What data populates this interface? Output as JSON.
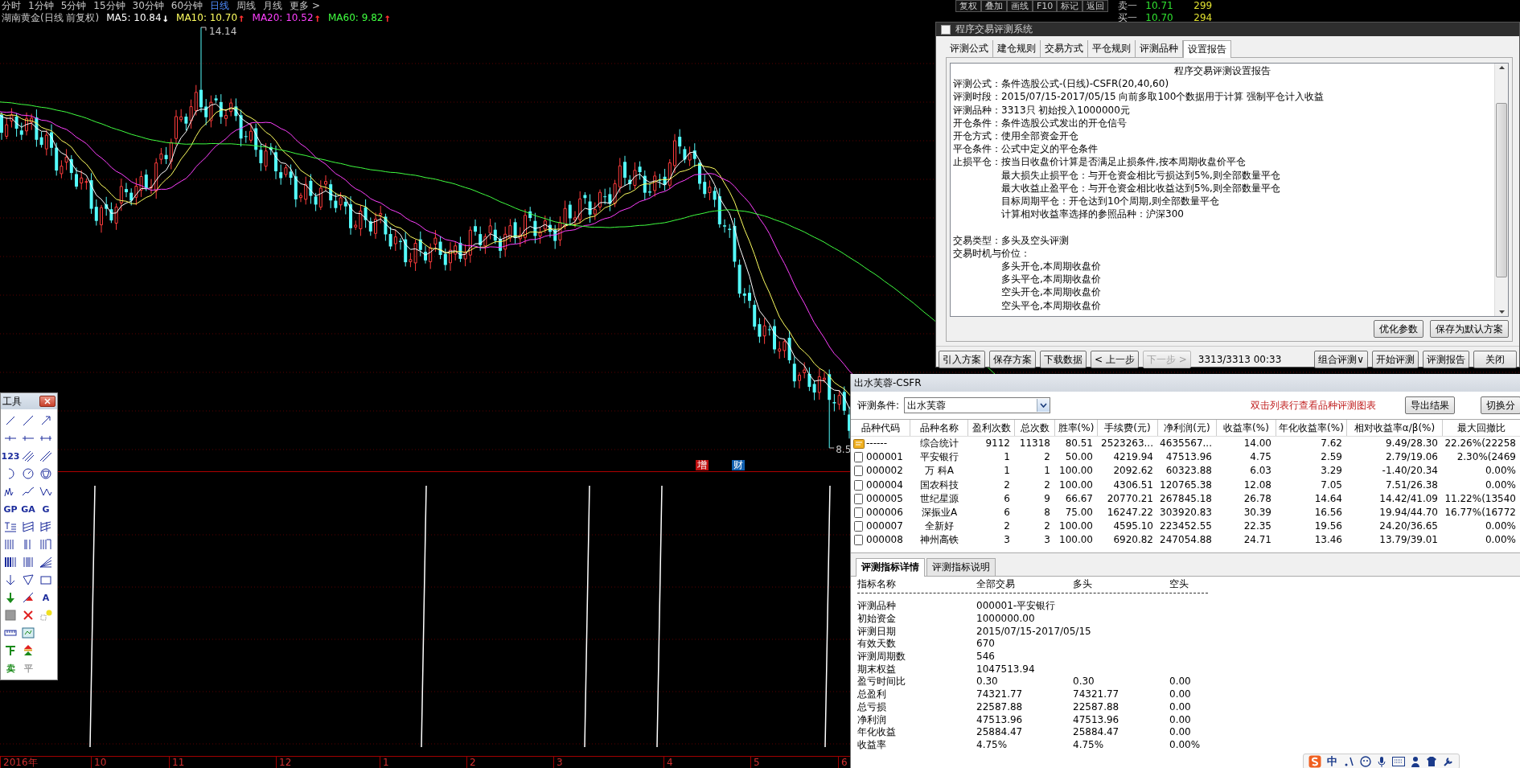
{
  "period_bar": {
    "periods": [
      {
        "label": "分时",
        "selected": false
      },
      {
        "label": "1分钟",
        "selected": false
      },
      {
        "label": "5分钟",
        "selected": false
      },
      {
        "label": "15分钟",
        "selected": false
      },
      {
        "label": "30分钟",
        "selected": false
      },
      {
        "label": "60分钟",
        "selected": false
      },
      {
        "label": "日线",
        "selected": true
      },
      {
        "label": "周线",
        "selected": false
      },
      {
        "label": "月线",
        "selected": false
      },
      {
        "label": "更多 >",
        "selected": false
      }
    ],
    "tools": [
      "复权",
      "叠加",
      "画线",
      "F10",
      "标记",
      "返回"
    ]
  },
  "quote": {
    "rows": [
      {
        "label": "卖一",
        "price": "10.71",
        "volume": "299"
      },
      {
        "label": "买一",
        "price": "10.70",
        "volume": "294"
      }
    ]
  },
  "chart": {
    "title": "湖南黄金(日线 前复权)",
    "ma": [
      {
        "label": "MA5: 10.84",
        "arrow": {
          "text": "↓",
          "color": "#ffffff"
        },
        "color": "#ffffff"
      },
      {
        "label": "MA10: 10.70",
        "arrow": {
          "text": "↑",
          "color": "#ff3030"
        },
        "color": "#ffff60"
      },
      {
        "label": "MA20: 10.52",
        "arrow": {
          "text": "↑",
          "color": "#ff3030"
        },
        "color": "#ff40ff"
      },
      {
        "label": "MA60: 9.82",
        "arrow": {
          "text": "↑",
          "color": "#ff3030"
        },
        "color": "#40ff40"
      }
    ],
    "high_label": "14.14",
    "low_label": "8.5",
    "markers": [
      {
        "label": "增",
        "color": "#c01010"
      },
      {
        "label": "财",
        "color": "#1060b0"
      }
    ],
    "x_axis": [
      "2016年",
      "10",
      "11",
      "12",
      "1",
      "2",
      "3",
      "4",
      "5",
      "6"
    ]
  },
  "toolbox": {
    "title": "工具",
    "tools": [
      {
        "kind": "icon"
      },
      {
        "kind": "icon"
      },
      {
        "kind": "icon"
      },
      {
        "kind": "icon"
      },
      {
        "kind": "icon"
      },
      {
        "kind": "icon"
      },
      {
        "kind": "text",
        "label": "123",
        "disabled": false
      },
      {
        "kind": "icon"
      },
      {
        "kind": "icon"
      },
      {
        "kind": "icon"
      },
      {
        "kind": "icon"
      },
      {
        "kind": "icon"
      },
      {
        "kind": "icon"
      },
      {
        "kind": "icon"
      },
      {
        "kind": "icon"
      },
      {
        "kind": "text",
        "label": "GP",
        "disabled": false
      },
      {
        "kind": "text",
        "label": "GA",
        "disabled": false
      },
      {
        "kind": "text",
        "label": "G",
        "disabled": false
      },
      {
        "kind": "icon"
      },
      {
        "kind": "icon"
      },
      {
        "kind": "icon"
      },
      {
        "kind": "icon"
      },
      {
        "kind": "icon"
      },
      {
        "kind": "icon"
      },
      {
        "kind": "icon"
      },
      {
        "kind": "icon"
      },
      {
        "kind": "icon"
      },
      {
        "kind": "icon"
      },
      {
        "kind": "icon"
      },
      {
        "kind": "icon"
      },
      {
        "kind": "icon"
      },
      {
        "kind": "icon"
      },
      {
        "kind": "text",
        "label": "A",
        "disabled": false
      },
      {
        "kind": "icon"
      },
      {
        "kind": "icon"
      },
      {
        "kind": "icon"
      },
      {
        "kind": "icon"
      },
      {
        "kind": "icon"
      },
      {
        "kind": "gap"
      },
      {
        "kind": "icon"
      },
      {
        "kind": "icon"
      },
      {
        "kind": "gap"
      },
      {
        "kind": "text",
        "label": "卖",
        "disabled": false
      },
      {
        "kind": "text",
        "label": "平",
        "disabled": true
      }
    ]
  },
  "report_window": {
    "title": "程序交易评测系统",
    "tabs": [
      {
        "label": "评测公式",
        "selected": false
      },
      {
        "label": "建仓规则",
        "selected": false
      },
      {
        "label": "交易方式",
        "selected": false
      },
      {
        "label": "平仓规则",
        "selected": false
      },
      {
        "label": "评测品种",
        "selected": false
      },
      {
        "label": "设置报告",
        "selected": true
      }
    ],
    "report_title": "程序交易评测设置报告",
    "sections": [
      {
        "lines": [
          {
            "kind": "field",
            "text": "评测公式：条件选股公式-(日线)-CSFR(20,40,60)"
          },
          {
            "kind": "field",
            "text": "评测时段：2015/07/15-2017/05/15 向前多取100个数据用于计算 强制平仓计入收益"
          },
          {
            "kind": "field",
            "text": "评测品种：3313只 初始投入1000000元"
          },
          {
            "kind": "field",
            "text": "开仓条件：条件选股公式发出的开仓信号"
          },
          {
            "kind": "field",
            "text": "开仓方式：使用全部资金开仓"
          },
          {
            "kind": "field",
            "text": "平仓条件：公式中定义的平仓条件"
          },
          {
            "kind": "field",
            "text": "止损平仓：按当日收盘价计算是否满足止损条件,按本周期收盘价平仓"
          },
          {
            "kind": "sub",
            "text": "最大损失止损平仓：与开仓资金相比亏损达到5%,则全部数量平仓"
          },
          {
            "kind": "sub",
            "text": "最大收益止盈平仓：与开仓资金相比收益达到5%,则全部数量平仓"
          },
          {
            "kind": "sub",
            "text": "目标周期平仓：开仓达到10个周期,则全部数量平仓"
          },
          {
            "kind": "sub",
            "text": "计算相对收益率选择的参照品种：沪深300"
          }
        ]
      },
      {
        "lines": [
          {
            "kind": "field",
            "text": "交易类型：多头及空头评测"
          },
          {
            "kind": "field",
            "text": "交易时机与价位："
          },
          {
            "kind": "sub",
            "text": "多头开仓,本周期收盘价"
          },
          {
            "kind": "sub",
            "text": "多头平仓,本周期收盘价"
          },
          {
            "kind": "sub",
            "text": "空头开仓,本周期收盘价"
          },
          {
            "kind": "sub",
            "text": "空头平仓,本周期收盘价"
          }
        ]
      }
    ],
    "side_buttons": [
      "优化参数",
      "保存为默认方案"
    ],
    "footer_left": [
      {
        "label": "引入方案",
        "disabled": false
      },
      {
        "label": "保存方案",
        "disabled": false
      },
      {
        "label": "下载数据",
        "disabled": false
      },
      {
        "label": "< 上一步",
        "disabled": false
      },
      {
        "label": "下一步 >",
        "disabled": true
      }
    ],
    "progress": "3313/3313 00:33",
    "footer_right": [
      {
        "label": "组合评测∨",
        "disabled": false
      },
      {
        "label": "开始评测",
        "disabled": false
      },
      {
        "label": "评测报告",
        "disabled": false
      },
      {
        "label": "关闭",
        "disabled": false
      }
    ]
  },
  "result_window": {
    "title": "出水芙蓉-CSFR",
    "condition_label": "评测条件:",
    "condition_value": "出水芙蓉",
    "hint": "双击列表行查看品种评测图表",
    "export_button": "导出结果",
    "switch_button": "切换分",
    "columns": [
      "品种代码",
      "品种名称",
      "盈利次数",
      "总次数",
      "胜率(%)",
      "手续费(元)",
      "净利润(元)",
      "收益率(%)",
      "年化收益率(%)",
      "相对收益率α/β(%)",
      "最大回撤比"
    ],
    "rows": [
      {
        "kind": "summary",
        "cells": [
          "------",
          "综合统计",
          "9112",
          "11318",
          "80.51",
          "2523263...",
          "4635567...",
          "14.00",
          "7.62",
          "9.49/28.30",
          "22.26%(22258"
        ]
      },
      {
        "kind": "stock",
        "cells": [
          "000001",
          "平安银行",
          "1",
          "2",
          "50.00",
          "4219.94",
          "47513.96",
          "4.75",
          "2.59",
          "2.79/19.06",
          "2.30%(2469"
        ]
      },
      {
        "kind": "stock",
        "cells": [
          "000002",
          "万 科A",
          "1",
          "1",
          "100.00",
          "2092.62",
          "60323.88",
          "6.03",
          "3.29",
          "-1.40/20.34",
          "0.00%"
        ]
      },
      {
        "kind": "stock",
        "cells": [
          "000004",
          "国农科技",
          "2",
          "2",
          "100.00",
          "4306.51",
          "120765.38",
          "12.08",
          "7.05",
          "7.51/26.38",
          "0.00%"
        ]
      },
      {
        "kind": "stock",
        "cells": [
          "000005",
          "世纪星源",
          "6",
          "9",
          "66.67",
          "20770.21",
          "267845.18",
          "26.78",
          "14.64",
          "14.42/41.09",
          "11.22%(13540"
        ]
      },
      {
        "kind": "stock",
        "cells": [
          "000006",
          "深振业A",
          "6",
          "8",
          "75.00",
          "16247.22",
          "303920.83",
          "30.39",
          "16.56",
          "19.94/44.70",
          "16.77%(16772"
        ]
      },
      {
        "kind": "stock",
        "cells": [
          "000007",
          "全新好",
          "2",
          "2",
          "100.00",
          "4595.10",
          "223452.55",
          "22.35",
          "19.56",
          "24.20/36.65",
          "0.00%"
        ]
      },
      {
        "kind": "stock",
        "cells": [
          "000008",
          "神州高铁",
          "3",
          "3",
          "100.00",
          "6920.82",
          "247054.88",
          "24.71",
          "13.46",
          "13.79/39.01",
          "0.00%"
        ]
      }
    ],
    "detail_tabs": [
      {
        "label": "评测指标详情",
        "selected": true
      },
      {
        "label": "评测指标说明",
        "selected": false
      }
    ],
    "detail_columns": [
      "指标名称",
      "全部交易",
      "多头",
      "空头"
    ],
    "detail_rows": [
      [
        "评测品种",
        "000001-平安银行"
      ],
      [
        "初始资金",
        "1000000.00"
      ],
      [
        "评测日期",
        "2015/07/15-2017/05/15"
      ],
      [
        "有效天数",
        "670"
      ],
      [
        "评测周期数",
        "546"
      ],
      [
        "期末权益",
        "1047513.94"
      ],
      [
        "盈亏时间比",
        "0.30",
        "0.30",
        "0.00"
      ],
      [
        "总盈利",
        "74321.77",
        "74321.77",
        "0.00"
      ],
      [
        "总亏损",
        "22587.88",
        "22587.88",
        "0.00"
      ],
      [
        "净利润",
        "47513.96",
        "47513.96",
        "0.00"
      ],
      [
        "年化收益",
        "25884.47",
        "25884.47",
        "0.00"
      ],
      [
        "收益率",
        "4.75%",
        "4.75%",
        "0.00%"
      ]
    ]
  },
  "ime_bar": {
    "mode": "中"
  }
}
